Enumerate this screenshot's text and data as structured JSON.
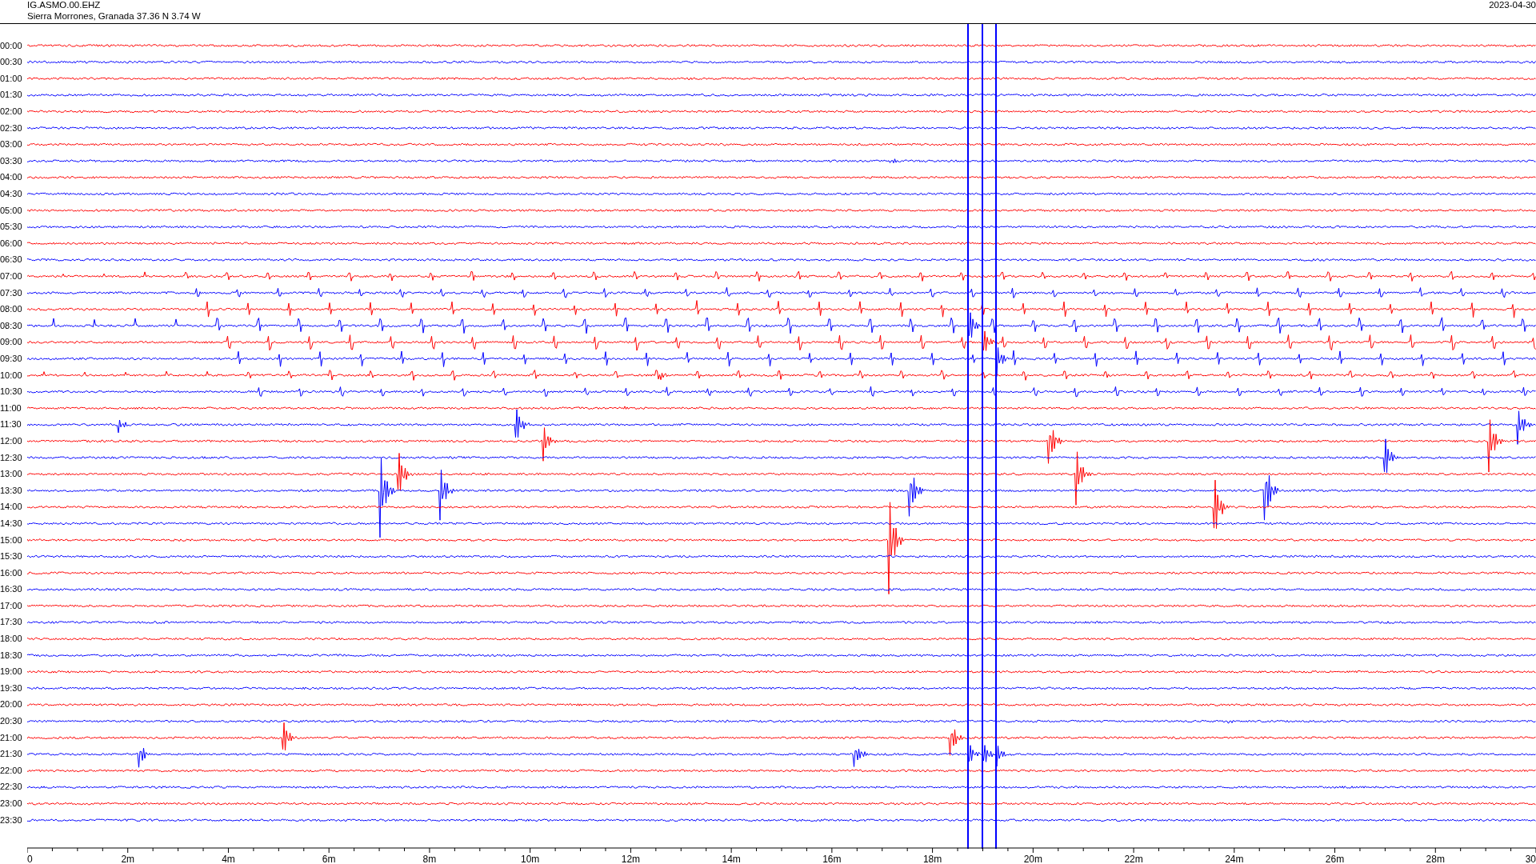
{
  "header": {
    "station": "IG.ASMO.00.EHZ",
    "location": "Sierra Morrones, Granada  37.36 N 3.74 W",
    "date": "2023-04-30"
  },
  "rows": [
    {
      "label": "00:00",
      "color": "#ff0000"
    },
    {
      "label": "00:30",
      "color": "#0000ff"
    },
    {
      "label": "01:00",
      "color": "#ff0000"
    },
    {
      "label": "01:30",
      "color": "#0000ff"
    },
    {
      "label": "02:00",
      "color": "#ff0000"
    },
    {
      "label": "02:30",
      "color": "#0000ff"
    },
    {
      "label": "03:00",
      "color": "#ff0000"
    },
    {
      "label": "03:30",
      "color": "#0000ff"
    },
    {
      "label": "04:00",
      "color": "#ff0000"
    },
    {
      "label": "04:30",
      "color": "#0000ff"
    },
    {
      "label": "05:00",
      "color": "#ff0000"
    },
    {
      "label": "05:30",
      "color": "#0000ff"
    },
    {
      "label": "06:00",
      "color": "#ff0000"
    },
    {
      "label": "06:30",
      "color": "#0000ff"
    },
    {
      "label": "07:00",
      "color": "#ff0000"
    },
    {
      "label": "07:30",
      "color": "#0000ff"
    },
    {
      "label": "08:00",
      "color": "#ff0000"
    },
    {
      "label": "08:30",
      "color": "#0000ff"
    },
    {
      "label": "09:00",
      "color": "#ff0000"
    },
    {
      "label": "09:30",
      "color": "#0000ff"
    },
    {
      "label": "10:00",
      "color": "#ff0000"
    },
    {
      "label": "10:30",
      "color": "#0000ff"
    },
    {
      "label": "11:00",
      "color": "#ff0000"
    },
    {
      "label": "11:30",
      "color": "#0000ff"
    },
    {
      "label": "12:00",
      "color": "#ff0000"
    },
    {
      "label": "12:30",
      "color": "#0000ff"
    },
    {
      "label": "13:00",
      "color": "#ff0000"
    },
    {
      "label": "13:30",
      "color": "#0000ff"
    },
    {
      "label": "14:00",
      "color": "#ff0000"
    },
    {
      "label": "14:30",
      "color": "#0000ff"
    },
    {
      "label": "15:00",
      "color": "#ff0000"
    },
    {
      "label": "15:30",
      "color": "#0000ff"
    },
    {
      "label": "16:00",
      "color": "#ff0000"
    },
    {
      "label": "16:30",
      "color": "#0000ff"
    },
    {
      "label": "17:00",
      "color": "#ff0000"
    },
    {
      "label": "17:30",
      "color": "#0000ff"
    },
    {
      "label": "18:00",
      "color": "#ff0000"
    },
    {
      "label": "18:30",
      "color": "#0000ff"
    },
    {
      "label": "19:00",
      "color": "#ff0000"
    },
    {
      "label": "19:30",
      "color": "#0000ff"
    },
    {
      "label": "20:00",
      "color": "#ff0000"
    },
    {
      "label": "20:30",
      "color": "#0000ff"
    },
    {
      "label": "21:00",
      "color": "#ff0000"
    },
    {
      "label": "21:30",
      "color": "#0000ff"
    },
    {
      "label": "22:00",
      "color": "#ff0000"
    },
    {
      "label": "22:30",
      "color": "#0000ff"
    },
    {
      "label": "23:00",
      "color": "#ff0000"
    },
    {
      "label": "23:30",
      "color": "#0000ff"
    }
  ],
  "axis": {
    "labels": [
      "0",
      "2m",
      "4m",
      "6m",
      "8m",
      "10m",
      "12m",
      "14m",
      "16m",
      "18m",
      "20m",
      "22m",
      "24m",
      "26m",
      "28m",
      "30"
    ]
  }
}
